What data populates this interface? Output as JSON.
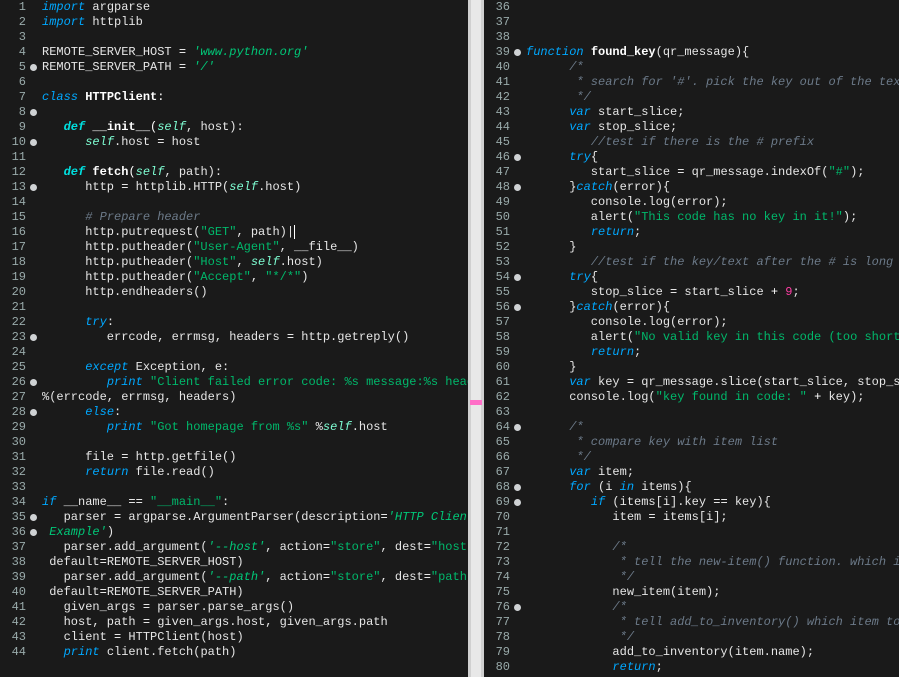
{
  "left": {
    "startLine": 1,
    "folds": [
      5,
      8,
      10,
      13,
      23,
      26,
      28,
      35,
      36
    ],
    "lines": [
      [
        [
          "import",
          "kw2"
        ],
        [
          " argparse",
          "id"
        ]
      ],
      [
        [
          "import",
          "kw2"
        ],
        [
          " httplib",
          "id"
        ]
      ],
      [
        [
          "",
          ""
        ]
      ],
      [
        [
          "REMOTE_SERVER_HOST ",
          "id"
        ],
        [
          "=",
          "op"
        ],
        [
          " ",
          "id"
        ],
        [
          "'www.python.org'",
          "str2"
        ]
      ],
      [
        [
          "REMOTE_SERVER_PATH ",
          "id"
        ],
        [
          "=",
          "op"
        ],
        [
          " ",
          "id"
        ],
        [
          "'/'",
          "str2"
        ]
      ],
      [
        [
          "",
          ""
        ]
      ],
      [
        [
          "class",
          "kw2"
        ],
        [
          " ",
          "id"
        ],
        [
          "HTTPClient",
          "fn"
        ],
        [
          ":",
          "op"
        ]
      ],
      [
        [
          "",
          ""
        ]
      ],
      [
        [
          "   ",
          "id"
        ],
        [
          "def",
          "def"
        ],
        [
          " ",
          "id"
        ],
        [
          "__init__",
          "fn"
        ],
        [
          "(",
          "op"
        ],
        [
          "self",
          "self"
        ],
        [
          ", host):",
          "id"
        ]
      ],
      [
        [
          "      ",
          "id"
        ],
        [
          "self",
          "self"
        ],
        [
          ".host ",
          "id"
        ],
        [
          "=",
          "op"
        ],
        [
          " host",
          "id"
        ]
      ],
      [
        [
          "",
          ""
        ]
      ],
      [
        [
          "   ",
          "id"
        ],
        [
          "def",
          "def"
        ],
        [
          " ",
          "id"
        ],
        [
          "fetch",
          "fn"
        ],
        [
          "(",
          "op"
        ],
        [
          "self",
          "self"
        ],
        [
          ", path):",
          "id"
        ]
      ],
      [
        [
          "      http ",
          "id"
        ],
        [
          "=",
          "op"
        ],
        [
          " httplib.HTTP(",
          "id"
        ],
        [
          "self",
          "self"
        ],
        [
          ".host)",
          "id"
        ]
      ],
      [
        [
          "",
          ""
        ]
      ],
      [
        [
          "      ",
          "id"
        ],
        [
          "# Prepare header",
          "cmt"
        ]
      ],
      [
        [
          "      http.putrequest(",
          "id"
        ],
        [
          "\"GET\"",
          "str"
        ],
        [
          ", path)",
          "id"
        ],
        [
          "|",
          "cursor"
        ]
      ],
      [
        [
          "      http.putheader(",
          "id"
        ],
        [
          "\"User-Agent\"",
          "str"
        ],
        [
          ", __file__)",
          "id"
        ]
      ],
      [
        [
          "      http.putheader(",
          "id"
        ],
        [
          "\"Host\"",
          "str"
        ],
        [
          ", ",
          "id"
        ],
        [
          "self",
          "self"
        ],
        [
          ".host)",
          "id"
        ]
      ],
      [
        [
          "      http.putheader(",
          "id"
        ],
        [
          "\"Accept\"",
          "str"
        ],
        [
          ", ",
          "id"
        ],
        [
          "\"*/*\"",
          "str"
        ],
        [
          ")",
          "id"
        ]
      ],
      [
        [
          "      http.endheaders()",
          "id"
        ]
      ],
      [
        [
          "",
          ""
        ]
      ],
      [
        [
          "      ",
          "id"
        ],
        [
          "try",
          "kw2"
        ],
        [
          ":",
          "id"
        ]
      ],
      [
        [
          "         errcode, errmsg, headers ",
          "id"
        ],
        [
          "=",
          "op"
        ],
        [
          " http.getreply()",
          "id"
        ]
      ],
      [
        [
          "",
          ""
        ]
      ],
      [
        [
          "      ",
          "id"
        ],
        [
          "except",
          "kw2"
        ],
        [
          " Exception, e:",
          "id"
        ]
      ],
      [
        [
          "         ",
          "id"
        ],
        [
          "print",
          "kw2"
        ],
        [
          " ",
          "id"
        ],
        [
          "\"Client failed error code: %s message:%s headers:",
          "str"
        ]
      ],
      [
        [
          "%(errcode, errmsg, headers)",
          "id"
        ]
      ],
      [
        [
          "      ",
          "id"
        ],
        [
          "else",
          "kw2"
        ],
        [
          ":",
          "id"
        ]
      ],
      [
        [
          "         ",
          "id"
        ],
        [
          "print",
          "kw2"
        ],
        [
          " ",
          "id"
        ],
        [
          "\"Got homepage from %s\"",
          "str"
        ],
        [
          " %",
          "id"
        ],
        [
          "self",
          "self"
        ],
        [
          ".host",
          "id"
        ]
      ],
      [
        [
          "",
          ""
        ]
      ],
      [
        [
          "      file ",
          "id"
        ],
        [
          "=",
          "op"
        ],
        [
          " http.getfile()",
          "id"
        ]
      ],
      [
        [
          "      ",
          "id"
        ],
        [
          "return",
          "kw2"
        ],
        [
          " file.read()",
          "id"
        ]
      ],
      [
        [
          "",
          ""
        ]
      ],
      [
        [
          "if",
          "kw2"
        ],
        [
          " __name__ ",
          "id"
        ],
        [
          "==",
          "op"
        ],
        [
          " ",
          "id"
        ],
        [
          "\"__main__\"",
          "str"
        ],
        [
          ":",
          "id"
        ]
      ],
      [
        [
          "   parser ",
          "id"
        ],
        [
          "=",
          "op"
        ],
        [
          " argparse.ArgumentParser(description",
          "id"
        ],
        [
          "=",
          "op"
        ],
        [
          "'HTTP Client",
          "str2"
        ]
      ],
      [
        [
          " Example'",
          "str2"
        ],
        [
          ")",
          "id"
        ]
      ],
      [
        [
          "   parser.add_argument(",
          "id"
        ],
        [
          "'--host'",
          "str2"
        ],
        [
          ", action",
          "id"
        ],
        [
          "=",
          "op"
        ],
        [
          "\"store\"",
          "str"
        ],
        [
          ", dest",
          "id"
        ],
        [
          "=",
          "op"
        ],
        [
          "\"host\"",
          "str"
        ],
        [
          ",",
          "id"
        ]
      ],
      [
        [
          " default",
          "id"
        ],
        [
          "=",
          "op"
        ],
        [
          "REMOTE_SERVER_HOST)",
          "id"
        ]
      ],
      [
        [
          "   parser.add_argument(",
          "id"
        ],
        [
          "'--path'",
          "str2"
        ],
        [
          ", action",
          "id"
        ],
        [
          "=",
          "op"
        ],
        [
          "\"store\"",
          "str"
        ],
        [
          ", dest",
          "id"
        ],
        [
          "=",
          "op"
        ],
        [
          "\"path\"",
          "str"
        ],
        [
          ",",
          "id"
        ]
      ],
      [
        [
          " default",
          "id"
        ],
        [
          "=",
          "op"
        ],
        [
          "REMOTE_SERVER_PATH)",
          "id"
        ]
      ],
      [
        [
          "   given_args ",
          "id"
        ],
        [
          "=",
          "op"
        ],
        [
          " parser.parse_args()",
          "id"
        ]
      ],
      [
        [
          "   host, path ",
          "id"
        ],
        [
          "=",
          "op"
        ],
        [
          " given_args.host, given_args.path",
          "id"
        ]
      ],
      [
        [
          "   client ",
          "id"
        ],
        [
          "=",
          "op"
        ],
        [
          " HTTPClient(host)",
          "id"
        ]
      ],
      [
        [
          "   ",
          "id"
        ],
        [
          "print",
          "kw2"
        ],
        [
          " client.fetch(path)",
          "id"
        ]
      ]
    ]
  },
  "right": {
    "startLine": 36,
    "folds": [
      39,
      46,
      48,
      54,
      56,
      64,
      68,
      69,
      76
    ],
    "lines": [
      [
        [
          "",
          ""
        ]
      ],
      [
        [
          "",
          ""
        ]
      ],
      [
        [
          "",
          ""
        ]
      ],
      [
        [
          "function",
          "jkw"
        ],
        [
          " ",
          "id"
        ],
        [
          "found_key",
          "fn"
        ],
        [
          "(qr_message){",
          "id"
        ]
      ],
      [
        [
          "      ",
          "id"
        ],
        [
          "/*",
          "cmt"
        ]
      ],
      [
        [
          "       * search for '#'. pick the key out of the text ",
          "cmt"
        ]
      ],
      [
        [
          "       */",
          "cmt"
        ]
      ],
      [
        [
          "      ",
          "id"
        ],
        [
          "var",
          "jkw"
        ],
        [
          " start_slice;",
          "id"
        ]
      ],
      [
        [
          "      ",
          "id"
        ],
        [
          "var",
          "jkw"
        ],
        [
          " stop_slice;",
          "id"
        ]
      ],
      [
        [
          "         ",
          "id"
        ],
        [
          "//test if there is the # prefix",
          "cmt"
        ]
      ],
      [
        [
          "      ",
          "id"
        ],
        [
          "try",
          "jkw"
        ],
        [
          "{",
          "id"
        ]
      ],
      [
        [
          "         start_slice ",
          "id"
        ],
        [
          "=",
          "op"
        ],
        [
          " qr_message.indexOf(",
          "id"
        ],
        [
          "\"#\"",
          "str"
        ],
        [
          ");",
          "id"
        ]
      ],
      [
        [
          "      }",
          "id"
        ],
        [
          "catch",
          "jkw"
        ],
        [
          "(error){",
          "id"
        ]
      ],
      [
        [
          "         console.log(error);",
          "id"
        ]
      ],
      [
        [
          "         alert(",
          "id"
        ],
        [
          "\"This code has no key in it!\"",
          "str"
        ],
        [
          ");",
          "id"
        ]
      ],
      [
        [
          "         ",
          "id"
        ],
        [
          "return",
          "jkw"
        ],
        [
          ";",
          "id"
        ]
      ],
      [
        [
          "      }",
          "id"
        ]
      ],
      [
        [
          "         ",
          "id"
        ],
        [
          "//test if the key/text after the # is long e",
          "cmt"
        ]
      ],
      [
        [
          "      ",
          "id"
        ],
        [
          "try",
          "jkw"
        ],
        [
          "{",
          "id"
        ]
      ],
      [
        [
          "         stop_slice ",
          "id"
        ],
        [
          "=",
          "op"
        ],
        [
          " start_slice ",
          "id"
        ],
        [
          "+",
          "op"
        ],
        [
          " ",
          "id"
        ],
        [
          "9",
          "num"
        ],
        [
          ";",
          "id"
        ]
      ],
      [
        [
          "      }",
          "id"
        ],
        [
          "catch",
          "jkw"
        ],
        [
          "(error){",
          "id"
        ]
      ],
      [
        [
          "         console.log(error);",
          "id"
        ]
      ],
      [
        [
          "         alert(",
          "id"
        ],
        [
          "\"No valid key in this code (too short)",
          "str"
        ]
      ],
      [
        [
          "         ",
          "id"
        ],
        [
          "return",
          "jkw"
        ],
        [
          ";",
          "id"
        ]
      ],
      [
        [
          "      }",
          "id"
        ]
      ],
      [
        [
          "      ",
          "id"
        ],
        [
          "var",
          "jkw"
        ],
        [
          " key ",
          "id"
        ],
        [
          "=",
          "op"
        ],
        [
          " qr_message.slice(start_slice, stop_sli",
          "id"
        ]
      ],
      [
        [
          "      console.log(",
          "id"
        ],
        [
          "\"key found in code: \"",
          "str"
        ],
        [
          " ",
          "id"
        ],
        [
          "+",
          "op"
        ],
        [
          " key);",
          "id"
        ]
      ],
      [
        [
          "",
          ""
        ]
      ],
      [
        [
          "      ",
          "id"
        ],
        [
          "/*",
          "cmt"
        ]
      ],
      [
        [
          "       * compare key with item list",
          "cmt"
        ]
      ],
      [
        [
          "       */",
          "cmt"
        ]
      ],
      [
        [
          "      ",
          "id"
        ],
        [
          "var",
          "jkw"
        ],
        [
          " item;",
          "id"
        ]
      ],
      [
        [
          "      ",
          "id"
        ],
        [
          "for",
          "jkw"
        ],
        [
          " (i ",
          "id"
        ],
        [
          "in",
          "jkw"
        ],
        [
          " items){",
          "id"
        ]
      ],
      [
        [
          "         ",
          "id"
        ],
        [
          "if",
          "jkw"
        ],
        [
          " (items[i].key ",
          "id"
        ],
        [
          "==",
          "op"
        ],
        [
          " key){",
          "id"
        ]
      ],
      [
        [
          "            item ",
          "id"
        ],
        [
          "=",
          "op"
        ],
        [
          " items[i];",
          "id"
        ]
      ],
      [
        [
          "",
          ""
        ]
      ],
      [
        [
          "            ",
          "id"
        ],
        [
          "/*",
          "cmt"
        ]
      ],
      [
        [
          "             * tell the new-item() function. which i",
          "cmt"
        ]
      ],
      [
        [
          "             */",
          "cmt"
        ]
      ],
      [
        [
          "            new_item(item);",
          "id"
        ]
      ],
      [
        [
          "            ",
          "id"
        ],
        [
          "/*",
          "cmt"
        ]
      ],
      [
        [
          "             * tell add_to_inventory() which item to",
          "cmt"
        ]
      ],
      [
        [
          "             */",
          "cmt"
        ]
      ],
      [
        [
          "            add_to_inventory(item.name);",
          "id"
        ]
      ],
      [
        [
          "            ",
          "id"
        ],
        [
          "return",
          "jkw"
        ],
        [
          ";",
          "id"
        ]
      ]
    ]
  }
}
